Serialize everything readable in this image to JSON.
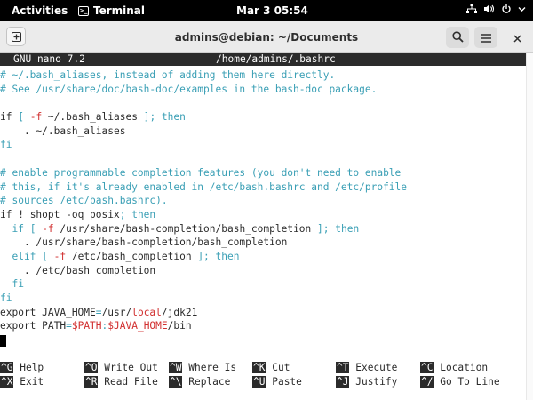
{
  "topbar": {
    "activities": "Activities",
    "app_name": "Terminal",
    "clock": "Mar 3  05:54"
  },
  "window": {
    "title": "admins@debian: ~/Documents"
  },
  "nano": {
    "version": "GNU nano 7.2",
    "filename": "/home/admins/.bashrc"
  },
  "editor_lines": [
    [
      {
        "t": "# ~/.bash_aliases, instead of adding them here directly.",
        "c": "c"
      }
    ],
    [
      {
        "t": "# See /usr/share/doc/bash-doc/examples in the bash-doc package.",
        "c": "c"
      }
    ],
    [
      {
        "t": "",
        "c": ""
      }
    ],
    [
      {
        "t": "if",
        "c": ""
      },
      {
        "t": " [ ",
        "c": "o"
      },
      {
        "t": "-f",
        "c": "r"
      },
      {
        "t": " ~/.bash_aliases ",
        "c": ""
      },
      {
        "t": "]; then",
        "c": "o"
      }
    ],
    [
      {
        "t": "    . ~/.bash_aliases",
        "c": ""
      }
    ],
    [
      {
        "t": "fi",
        "c": "c"
      }
    ],
    [
      {
        "t": "",
        "c": ""
      }
    ],
    [
      {
        "t": "# enable programmable completion features (you don't need to enable",
        "c": "c"
      }
    ],
    [
      {
        "t": "# this, if it's already enabled in /etc/bash.bashrc and /etc/profile",
        "c": "c"
      }
    ],
    [
      {
        "t": "# sources /etc/bash.bashrc).",
        "c": "c"
      }
    ],
    [
      {
        "t": "if",
        "c": ""
      },
      {
        "t": " ! shopt -oq posix",
        "c": ""
      },
      {
        "t": "; then",
        "c": "o"
      }
    ],
    [
      {
        "t": "  if",
        "c": "c"
      },
      {
        "t": " [ ",
        "c": "o"
      },
      {
        "t": "-f",
        "c": "r"
      },
      {
        "t": " /usr/share/bash-completion/bash_completion ",
        "c": ""
      },
      {
        "t": "]; then",
        "c": "o"
      }
    ],
    [
      {
        "t": "    . /usr/share/bash-completion/bash_completion",
        "c": ""
      }
    ],
    [
      {
        "t": "  elif",
        "c": "c"
      },
      {
        "t": " [ ",
        "c": "o"
      },
      {
        "t": "-f",
        "c": "r"
      },
      {
        "t": " /etc/bash_completion ",
        "c": ""
      },
      {
        "t": "]; then",
        "c": "o"
      }
    ],
    [
      {
        "t": "    . /etc/bash_completion",
        "c": ""
      }
    ],
    [
      {
        "t": "  fi",
        "c": "c"
      }
    ],
    [
      {
        "t": "fi",
        "c": "c"
      }
    ],
    [
      {
        "t": "export JAVA_HOME",
        "c": ""
      },
      {
        "t": "=",
        "c": "o"
      },
      {
        "t": "/usr/",
        "c": ""
      },
      {
        "t": "local",
        "c": "r"
      },
      {
        "t": "/jdk21",
        "c": ""
      }
    ],
    [
      {
        "t": "export PATH",
        "c": ""
      },
      {
        "t": "=",
        "c": "o"
      },
      {
        "t": "$PATH",
        "c": "r"
      },
      {
        "t": ":",
        "c": "o"
      },
      {
        "t": "$JAVA_HOME",
        "c": "r"
      },
      {
        "t": "/bin",
        "c": ""
      }
    ]
  ],
  "shortcuts": [
    [
      {
        "key": "^G",
        "label": "Help"
      },
      {
        "key": "^O",
        "label": "Write Out"
      },
      {
        "key": "^W",
        "label": "Where Is"
      },
      {
        "key": "^K",
        "label": "Cut"
      },
      {
        "key": "^T",
        "label": "Execute"
      },
      {
        "key": "^C",
        "label": "Location"
      }
    ],
    [
      {
        "key": "^X",
        "label": "Exit"
      },
      {
        "key": "^R",
        "label": "Read File"
      },
      {
        "key": "^\\",
        "label": "Replace"
      },
      {
        "key": "^U",
        "label": "Paste"
      },
      {
        "key": "^J",
        "label": "Justify"
      },
      {
        "key": "^/",
        "label": "Go To Line"
      }
    ]
  ],
  "colors": {
    "comment": "#3a9fb5",
    "variable": "#d12f2f",
    "titlebar": "#2b2b2b"
  },
  "icons": [
    "terminal-icon",
    "network-icon",
    "volume-icon",
    "power-icon",
    "new-tab-icon",
    "search-icon",
    "hamburger-menu-icon",
    "close-icon"
  ]
}
